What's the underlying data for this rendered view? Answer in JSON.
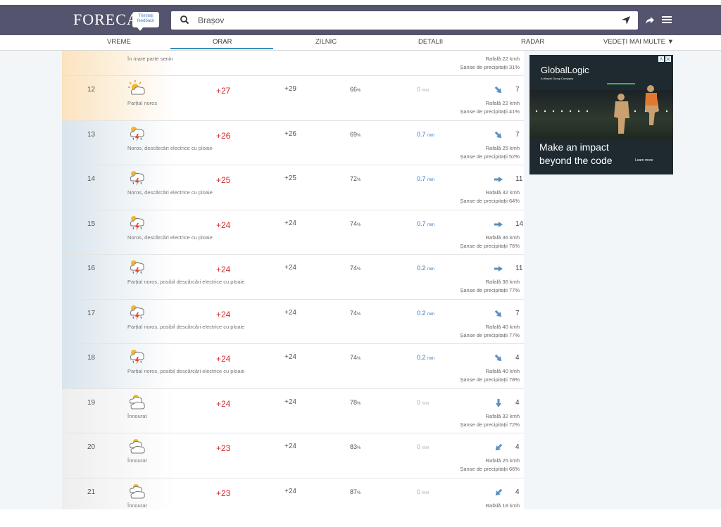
{
  "header": {
    "logo_text": "FORECA",
    "feedback_line1": "Trimiteți",
    "feedback_line2": "feedback",
    "search_value": "Brașov"
  },
  "nav": {
    "tabs": [
      {
        "label": "VREME"
      },
      {
        "label": "ORAR"
      },
      {
        "label": "ZILNIC"
      },
      {
        "label": "DETALII"
      },
      {
        "label": "RADAR"
      },
      {
        "label": "VEDEȚI MAI MULTE ▼"
      }
    ],
    "active": "ORAR"
  },
  "top_partial": {
    "desc": "În mare parte senin",
    "gust": "Rafală 22 kmh",
    "chance": "Șanse de precipitații 31%"
  },
  "rows": [
    {
      "hour": "12",
      "icon": "partly-cloudy-icon",
      "temp": "+27",
      "feels": "+29",
      "hum": "66",
      "hum_unit": "%",
      "prec": "0",
      "prec_unit": "mm",
      "prec_color": "#aaaaaa",
      "wind_dir": "northwest-wind",
      "speed": "7",
      "gust": "Rafală 22 kmh",
      "chance": "Șanse de precipitații 41%",
      "desc": "Parțial noros"
    },
    {
      "hour": "13",
      "icon": "thunderstorm-rain-icon",
      "temp": "+26",
      "feels": "+26",
      "hum": "69",
      "hum_unit": "%",
      "prec": "0.7",
      "prec_unit": "mm",
      "prec_color": "#3a78c2",
      "wind_dir": "northwest-wind",
      "speed": "7",
      "gust": "Rafală 25 kmh",
      "chance": "Șanse de precipitații 52%",
      "desc": "Noros, descărcări electrice cu ploaie"
    },
    {
      "hour": "14",
      "icon": "thunderstorm-rain-icon",
      "temp": "+25",
      "feels": "+25",
      "hum": "72",
      "hum_unit": "%",
      "prec": "0.7",
      "prec_unit": "mm",
      "prec_color": "#3a78c2",
      "wind_dir": "west-wind",
      "speed": "11",
      "gust": "Rafală 32 kmh",
      "chance": "Șanse de precipitații 64%",
      "desc": "Noros, descărcări electrice cu ploaie"
    },
    {
      "hour": "15",
      "icon": "thunderstorm-rain-icon",
      "temp": "+24",
      "feels": "+24",
      "hum": "74",
      "hum_unit": "%",
      "prec": "0.7",
      "prec_unit": "mm",
      "prec_color": "#3a78c2",
      "wind_dir": "west-wind",
      "speed": "14",
      "gust": "Rafală 36 kmh",
      "chance": "Șanse de precipitații 76%",
      "desc": "Noros, descărcări electrice cu ploaie"
    },
    {
      "hour": "16",
      "icon": "thunderstorm-rain-icon",
      "temp": "+24",
      "feels": "+24",
      "hum": "74",
      "hum_unit": "%",
      "prec": "0.2",
      "prec_unit": "mm",
      "prec_color": "#3a78c2",
      "wind_dir": "west-wind",
      "speed": "11",
      "gust": "Rafală 36 kmh",
      "chance": "Șanse de precipitații 77%",
      "desc": "Parțial noros, posibil descărcări electrice cu ploaie"
    },
    {
      "hour": "17",
      "icon": "thunderstorm-rain-icon",
      "temp": "+24",
      "feels": "+24",
      "hum": "74",
      "hum_unit": "%",
      "prec": "0.2",
      "prec_unit": "mm",
      "prec_color": "#3a78c2",
      "wind_dir": "northwest-wind",
      "speed": "7",
      "gust": "Rafală 40 kmh",
      "chance": "Șanse de precipitații 77%",
      "desc": "Parțial noros, posibil descărcări electrice cu ploaie"
    },
    {
      "hour": "18",
      "icon": "thunderstorm-rain-icon",
      "temp": "+24",
      "feels": "+24",
      "hum": "74",
      "hum_unit": "%",
      "prec": "0.2",
      "prec_unit": "mm",
      "prec_color": "#3a78c2",
      "wind_dir": "northwest-wind",
      "speed": "4",
      "gust": "Rafală 40 kmh",
      "chance": "Șanse de precipitații 78%",
      "desc": "Parțial noros, posibil descărcări electrice cu ploaie"
    },
    {
      "hour": "19",
      "icon": "overcast-icon",
      "temp": "+24",
      "feels": "+24",
      "hum": "78",
      "hum_unit": "%",
      "prec": "0",
      "prec_unit": "mm",
      "prec_color": "#aaaaaa",
      "wind_dir": "north-wind",
      "speed": "4",
      "gust": "Rafală 32 kmh",
      "chance": "Șanse de precipitații 72%",
      "desc": "Înnourat"
    },
    {
      "hour": "20",
      "icon": "overcast-icon",
      "temp": "+23",
      "feels": "+24",
      "hum": "83",
      "hum_unit": "%",
      "prec": "0",
      "prec_unit": "mm",
      "prec_color": "#aaaaaa",
      "wind_dir": "northeast-wind",
      "speed": "4",
      "gust": "Rafală 25 kmh",
      "chance": "Șanse de precipitații 66%",
      "desc": "Înnourat"
    },
    {
      "hour": "21",
      "icon": "overcast-icon",
      "temp": "+23",
      "feels": "+24",
      "hum": "87",
      "hum_unit": "%",
      "prec": "0",
      "prec_unit": "mm",
      "prec_color": "#aaaaaa",
      "wind_dir": "northeast-wind",
      "speed": "4",
      "gust": "Rafală 18 kmh",
      "chance": "",
      "desc": "Înnourat"
    }
  ],
  "ad": {
    "brand": "GlobalLogic",
    "brand_sub": "A Hitachi Group Company",
    "headline_1": "Make an impact",
    "headline_2": "beyond the code",
    "learn": "Learn more"
  },
  "colors": {
    "header_bg": "#54546e",
    "temp_red": "#d62b2b",
    "accent_blue": "#3a8fb7",
    "wind_arrow": "#5a90c0",
    "day_strip": "#fbe3bf",
    "storm_strip": "#d9e4ec",
    "evening_strip": "#eeeeee"
  }
}
